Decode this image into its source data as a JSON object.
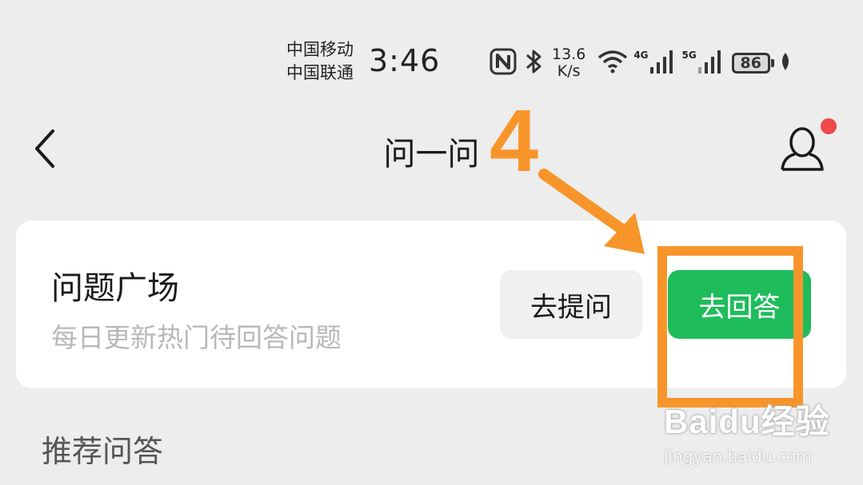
{
  "status_bar": {
    "carrier_1": "中国移动",
    "carrier_2": "中国联通",
    "time": "3:46",
    "speed_value": "13.6",
    "speed_unit": "K/s",
    "net_1": "4G",
    "net_2": "5G",
    "battery": "86",
    "icons": [
      "nfc-icon",
      "bluetooth-icon",
      "wifi-icon",
      "signal-icon",
      "battery-icon",
      "leaf-icon"
    ]
  },
  "nav": {
    "title": "问一问",
    "icons": [
      "back-arrow-icon",
      "profile-icon"
    ],
    "notification_color": "#ee4a4a"
  },
  "card": {
    "title": "问题广场",
    "subtitle": "每日更新热门待回答问题",
    "ask_label": "去提问",
    "answer_label": "去回答",
    "answer_color": "#1fbc5b"
  },
  "section": {
    "heading": "推荐问答"
  },
  "annotation": {
    "step": "4",
    "color": "#f7952b"
  },
  "watermark": {
    "logo": "Baidu经验",
    "url": "jingyan.baidu.com"
  }
}
